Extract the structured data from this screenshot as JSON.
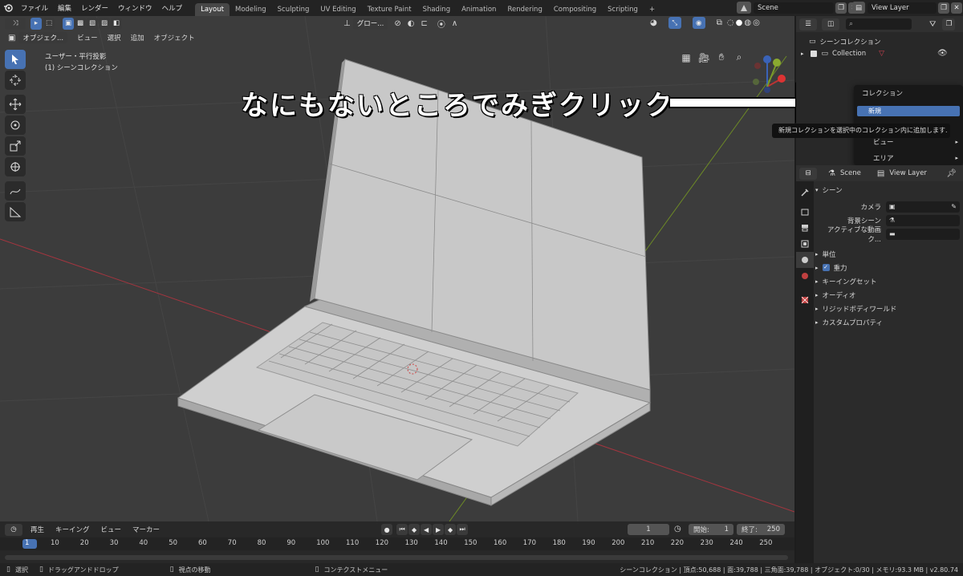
{
  "topbar": {
    "menus": [
      "ファイル",
      "編集",
      "レンダー",
      "ウィンドウ",
      "ヘルプ"
    ],
    "workspaces": [
      "Layout",
      "Modeling",
      "Sculpting",
      "UV Editing",
      "Texture Paint",
      "Shading",
      "Animation",
      "Rendering",
      "Compositing",
      "Scripting"
    ],
    "add_tab": "+",
    "scene_name": "Scene",
    "view_layer": "View Layer"
  },
  "viewport": {
    "mode": "オブジェク...",
    "menus": [
      "ビュー",
      "選択",
      "追加",
      "オブジェクト"
    ],
    "transform_orientation": "グロー...",
    "view_label": "ユーザー・平行投影",
    "collection_label": "(1) シーンコレクション"
  },
  "annotation": {
    "text": "なにもないところでみぎクリック",
    "arrow": "right-arrow"
  },
  "outliner": {
    "scene_collection": "シーンコレクション",
    "collection": "Collection"
  },
  "context_menu": {
    "title": "コレクション",
    "items": [
      "新規",
      "ビュー",
      "エリア"
    ],
    "highlighted": "新規",
    "tooltip": "新規コレクションを選択中のコレクション内に追加します."
  },
  "properties": {
    "header_scene": "Scene",
    "header_view_layer": "View Layer",
    "section": "シーン",
    "fields": [
      {
        "label": "カメラ"
      },
      {
        "label": "背景シーン"
      },
      {
        "label": "アクティブな動画ク..."
      }
    ],
    "subsections": [
      "単位",
      "重力",
      "キーイングセット",
      "オーディオ",
      "リジッドボディワールド",
      "カスタムプロパティ"
    ]
  },
  "timeline": {
    "menus": [
      "再生",
      "キーイング",
      "ビュー",
      "マーカー"
    ],
    "current_frame": "1",
    "start_label": "開始:",
    "start": "1",
    "end_label": "終了:",
    "end": "250",
    "ticks": [
      "1",
      "10",
      "20",
      "30",
      "40",
      "50",
      "60",
      "70",
      "80",
      "90",
      "100",
      "110",
      "120",
      "130",
      "140",
      "150",
      "160",
      "170",
      "180",
      "190",
      "200",
      "210",
      "220",
      "230",
      "240",
      "250"
    ]
  },
  "statusbar": {
    "select": "選択",
    "drag": "ドラッグアンドドロップ",
    "move_view": "視点の移動",
    "context_menu": "コンテクストメニュー",
    "stats": "シーンコレクション | 頂点:50,688 | 面:39,788 | 三角面:39,788 | オブジェクト:0/30 | メモリ:93.3 MB | v2.80.74"
  },
  "colors": {
    "accent": "#4772b3",
    "viewport_bg": "#3c3c3c",
    "x_axis": "#a3353f",
    "y_axis": "#7a9a2a"
  }
}
